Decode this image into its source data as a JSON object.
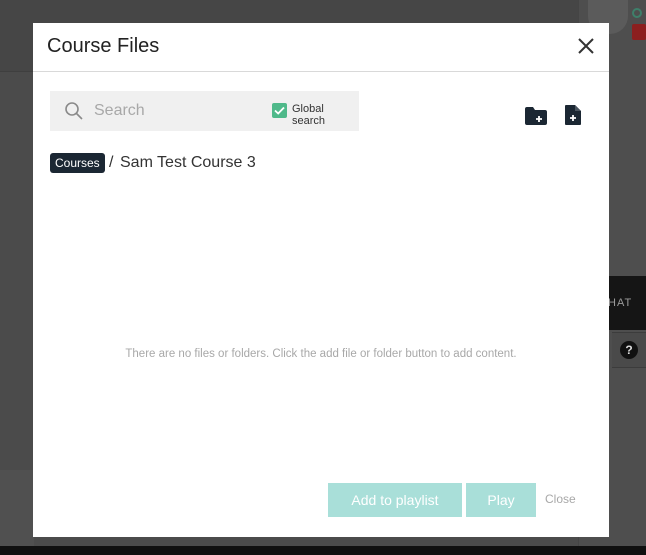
{
  "background": {
    "chat_tab_label": "HAT",
    "help_label": "?"
  },
  "modal": {
    "title": "Course Files",
    "close_icon": "close-icon",
    "search": {
      "placeholder": "Search",
      "value": "",
      "icon": "search-icon"
    },
    "global_search": {
      "label": "Global search",
      "checked": true,
      "color": "#4fb98a"
    },
    "actions": {
      "add_folder_icon": "folder-add-icon",
      "add_file_icon": "file-add-icon"
    },
    "breadcrumb": {
      "root": "Courses",
      "separator": "/",
      "current": "Sam Test Course 3"
    },
    "empty_message": "There are no files or folders. Click the add file or folder button to add content.",
    "footer": {
      "add_to_playlist": "Add to playlist",
      "play": "Play",
      "close": "Close",
      "button_color": "#a9dfd9"
    }
  }
}
